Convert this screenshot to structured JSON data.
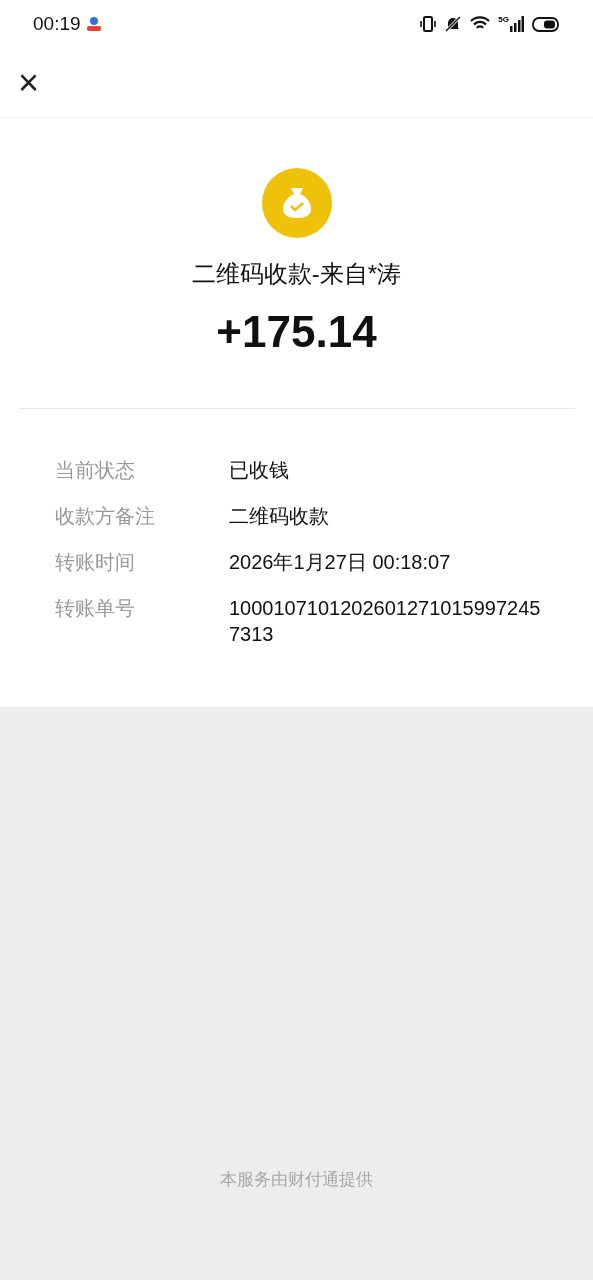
{
  "status_bar": {
    "time": "00:19",
    "network": "5G"
  },
  "header": {
    "close": "×"
  },
  "payment": {
    "title": "二维码收款-来自*涛",
    "amount": "+175.14"
  },
  "details": [
    {
      "label": "当前状态",
      "value": "已收钱"
    },
    {
      "label": "收款方备注",
      "value": "二维码收款"
    },
    {
      "label": "转账时间",
      "value": "2026年1月27日 00:18:07"
    },
    {
      "label": "转账单号",
      "value": "10001071012026012710159972457313"
    }
  ],
  "footer": "本服务由财付通提供"
}
